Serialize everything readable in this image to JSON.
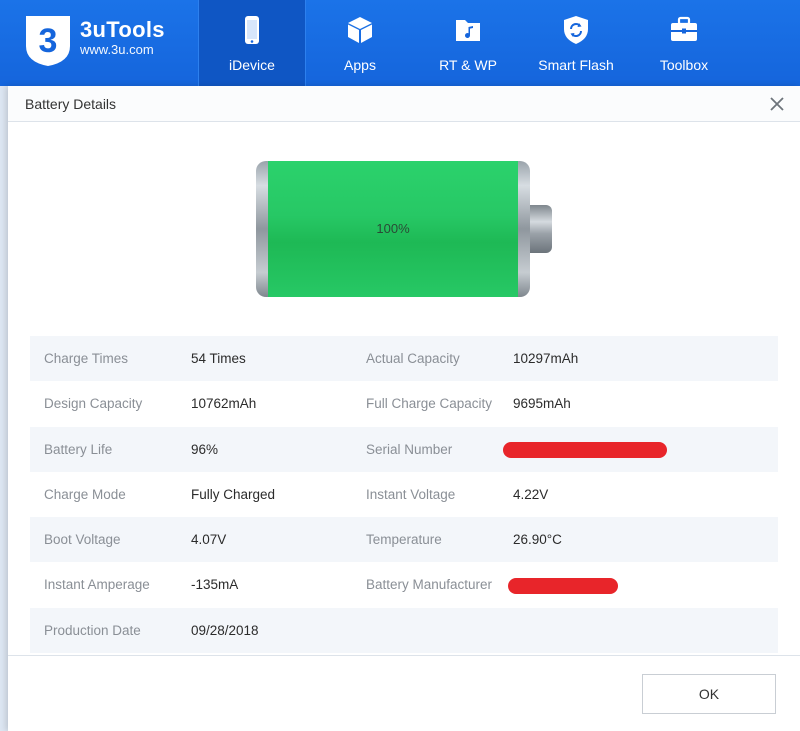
{
  "app": {
    "brand_name": "3uTools",
    "brand_url": "www.3u.com",
    "logo_digit": "3",
    "accent_color": "#1b73e8"
  },
  "nav": {
    "items": [
      {
        "label": "iDevice",
        "icon": "phone-icon",
        "active": true
      },
      {
        "label": "Apps",
        "icon": "cube-icon",
        "active": false
      },
      {
        "label": "RT & WP",
        "icon": "music-folder-icon",
        "active": false
      },
      {
        "label": "Smart Flash",
        "icon": "refresh-shield-icon",
        "active": false
      },
      {
        "label": "Toolbox",
        "icon": "toolbox-icon",
        "active": false
      }
    ]
  },
  "dialog": {
    "title": "Battery Details",
    "close_icon": "close-icon",
    "battery_level": 1.0,
    "battery_percent_label": "100%",
    "battery_color": "#27c865",
    "ok_label": "OK"
  },
  "details": {
    "rows": [
      {
        "l1": "Charge Times",
        "v1": "54 Times",
        "l2": "Actual Capacity",
        "v2": "10297mAh"
      },
      {
        "l1": "Design Capacity",
        "v1": "10762mAh",
        "l2": "Full Charge Capacity",
        "v2": "9695mAh"
      },
      {
        "l1": "Battery Life",
        "v1": "96%",
        "l2": "Serial Number",
        "v2": ""
      },
      {
        "l1": "Charge Mode",
        "v1": "Fully Charged",
        "l2": "Instant Voltage",
        "v2": "4.22V"
      },
      {
        "l1": "Boot Voltage",
        "v1": "4.07V",
        "l2": "Temperature",
        "v2": "26.90°C"
      },
      {
        "l1": "Instant Amperage",
        "v1": "-135mA",
        "l2": "Battery Manufacturer",
        "v2": ""
      },
      {
        "l1": "Production Date",
        "v1": "09/28/2018",
        "l2": "",
        "v2": ""
      }
    ],
    "redaction_color": "#e8252a"
  }
}
